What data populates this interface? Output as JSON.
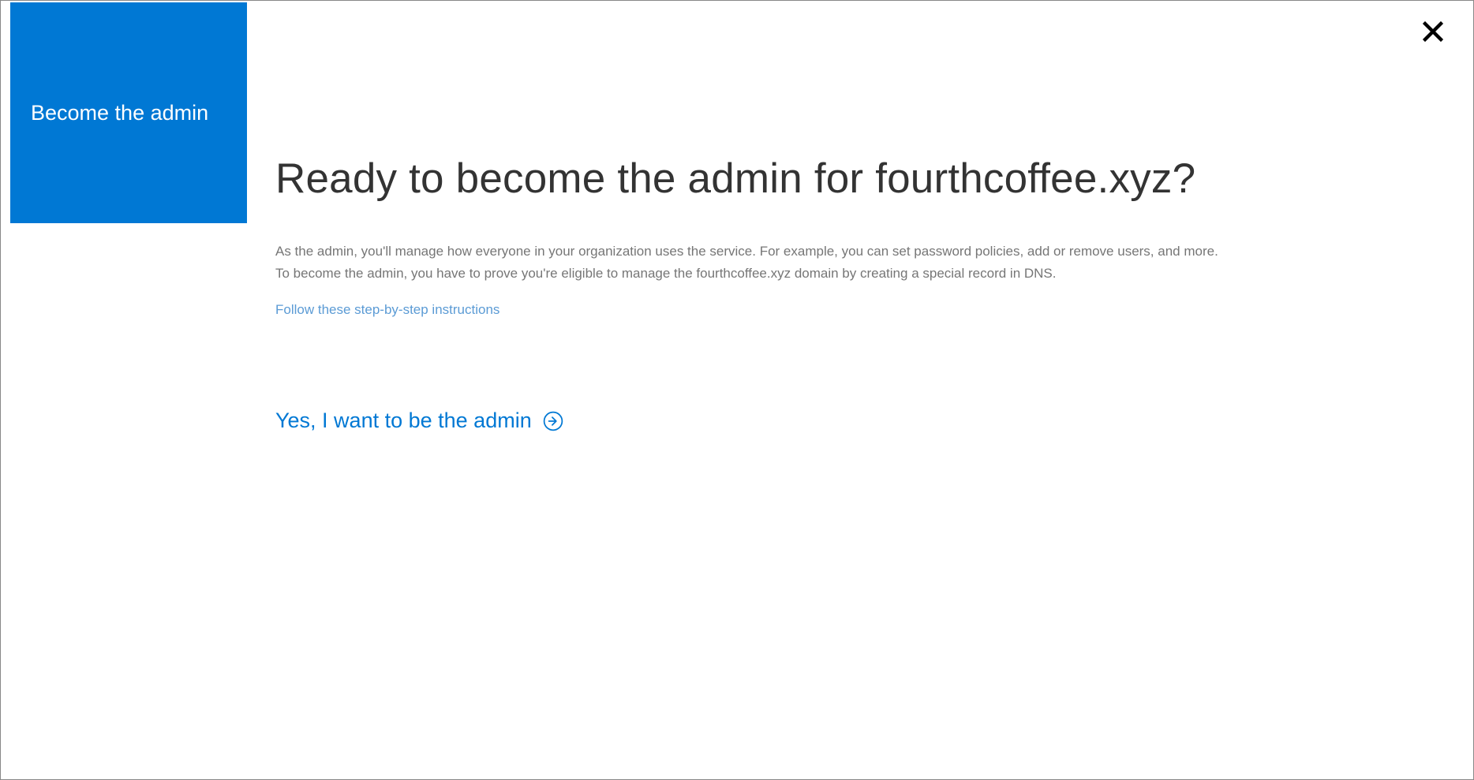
{
  "sidebar": {
    "label": "Become the admin"
  },
  "main": {
    "heading": "Ready to become the admin for fourthcoffee.xyz?",
    "description_line1": "As the admin, you'll manage how everyone in your organization uses the service. For example, you can set password policies, add or remove users, and more.",
    "description_line2": "To become the admin, you have to prove you're eligible to manage the fourthcoffee.xyz domain by creating a special record in DNS.",
    "instructions_link": "Follow these step-by-step instructions",
    "cta_label": "Yes, I want to be the admin"
  }
}
